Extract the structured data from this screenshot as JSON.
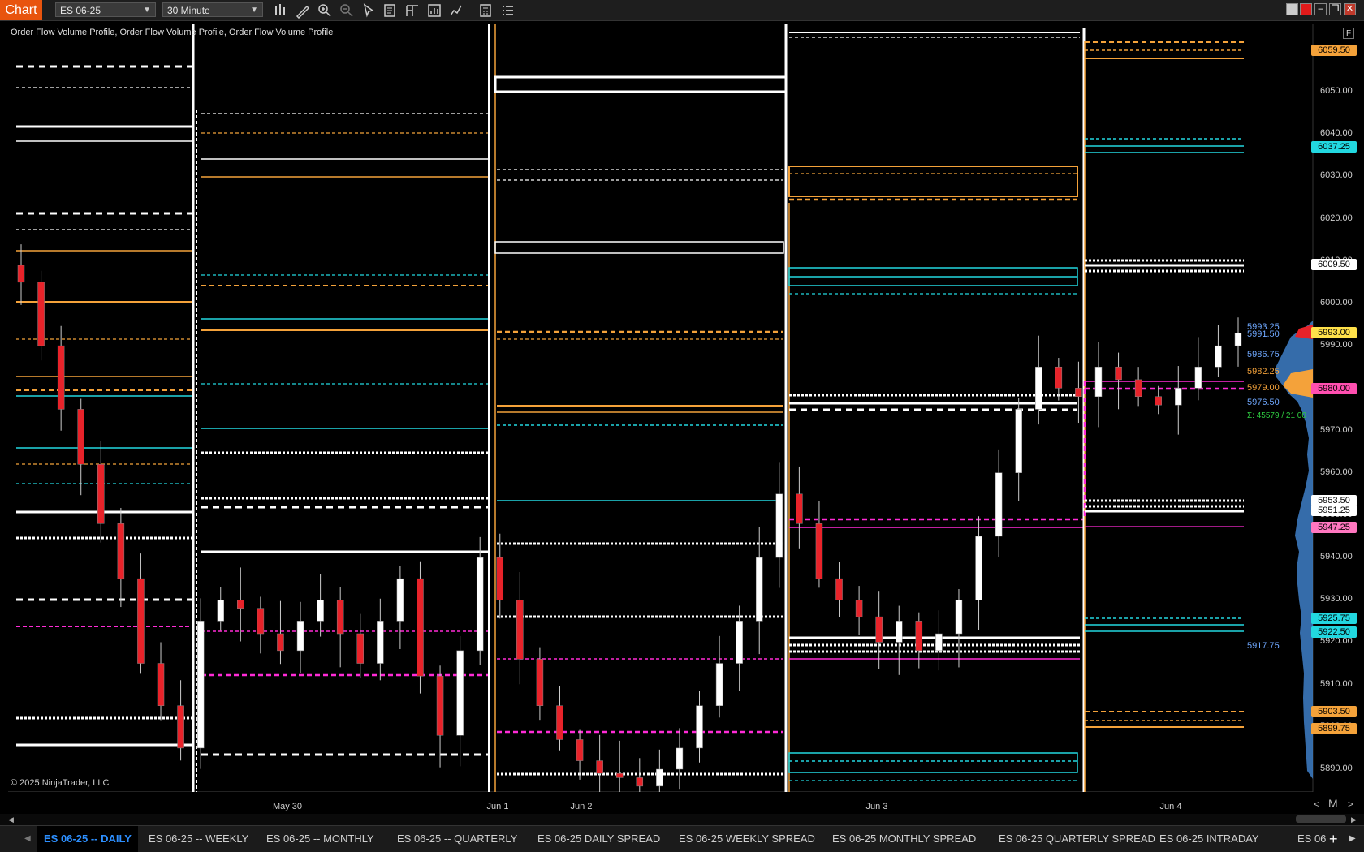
{
  "toolbar": {
    "chart_label": "Chart",
    "instrument": "ES 06-25",
    "interval": "30 Minute"
  },
  "indicator_label": "Order Flow Volume Profile, Order Flow Volume Profile, Order Flow Volume Profile",
  "copyright": "© 2025 NinjaTrader, LLC",
  "f_button": "F",
  "axis": {
    "ticks": [
      "6050.00",
      "6040.00",
      "6030.00",
      "6020.00",
      "6010.00",
      "6000.00",
      "5990.00",
      "5980.00",
      "5970.00",
      "5960.00",
      "5950.00",
      "5940.00",
      "5930.00",
      "5920.00",
      "5910.00",
      "5900.00",
      "5890.00"
    ],
    "x_labels": [
      "May 30",
      "Jun 1",
      "Jun 2",
      "Jun 3",
      "Jun 4"
    ]
  },
  "price_tags": [
    {
      "text": "6059.50",
      "color": "#f4a23a"
    },
    {
      "text": "6037.25",
      "color": "#22d8e0"
    },
    {
      "text": "6009.50",
      "color": "#ffffff"
    },
    {
      "text": "5993.00",
      "color": "#ffe14a"
    },
    {
      "text": "5980.00",
      "color": "#ff4fb0"
    },
    {
      "text": "5953.50",
      "color": "#ffffff"
    },
    {
      "text": "5951.25",
      "color": "#ffffff"
    },
    {
      "text": "5947.25",
      "color": "#ff77c0"
    },
    {
      "text": "5925.75",
      "color": "#22d8e0"
    },
    {
      "text": "5922.50",
      "color": "#22d8e0"
    },
    {
      "text": "5903.50",
      "color": "#f4a23a"
    },
    {
      "text": "5899.75",
      "color": "#f4a23a"
    }
  ],
  "profile_labels": [
    {
      "text": "5993.25",
      "color": "#6fa8ff"
    },
    {
      "text": "5991.50",
      "color": "#6fa8ff"
    },
    {
      "text": "5986.75",
      "color": "#6fa8ff"
    },
    {
      "text": "5982.25",
      "color": "#f4a23a"
    },
    {
      "text": "5979.00",
      "color": "#f4a23a"
    },
    {
      "text": "5976.50",
      "color": "#6fa8ff"
    },
    {
      "text": "Σ: 45579 / 21 00",
      "color": "#2ecc40"
    },
    {
      "text": "5917.75",
      "color": "#6fa8ff"
    }
  ],
  "zoom_controls": {
    "left": "<",
    "mode": "M",
    "right": ">"
  },
  "tabs": [
    "ES 06-25 -- DAILY",
    "ES 06-25 -- WEEKLY",
    "ES 06-25 -- MONTHLY",
    "ES 06-25 -- QUARTERLY",
    "ES 06-25 DAILY SPREAD",
    "ES 06-25 WEEKLY SPREAD",
    "ES 06-25 MONTHLY SPREAD",
    "ES 06-25 QUARTERLY SPREAD",
    "ES 06-25 INTRADAY",
    "ES 06"
  ],
  "add_tab": "+",
  "colors": {
    "accent": "#e8540e",
    "up": "#ffffff",
    "down": "#e8232a",
    "orange": "#f4a23a",
    "cyan": "#22d8e0",
    "magenta": "#ff2bd6",
    "profile": "#3e7fc8"
  },
  "price_series": [
    6005,
    5990,
    5975,
    5962,
    5948,
    5935,
    5915,
    5905,
    5895,
    5925,
    5930,
    5928,
    5922,
    5918,
    5925,
    5930,
    5922,
    5915,
    5925,
    5935,
    5912,
    5898,
    5918,
    5940,
    5930,
    5916,
    5905,
    5897,
    5892,
    5889,
    5888,
    5886,
    5890,
    5895,
    5905,
    5915,
    5925,
    5940,
    5955,
    5948,
    5935,
    5930,
    5926,
    5920,
    5925,
    5918,
    5922,
    5930,
    5945,
    5960,
    5975,
    5985,
    5980,
    5978,
    5985,
    5982,
    5978,
    5976,
    5980,
    5985,
    5990,
    5993
  ]
}
